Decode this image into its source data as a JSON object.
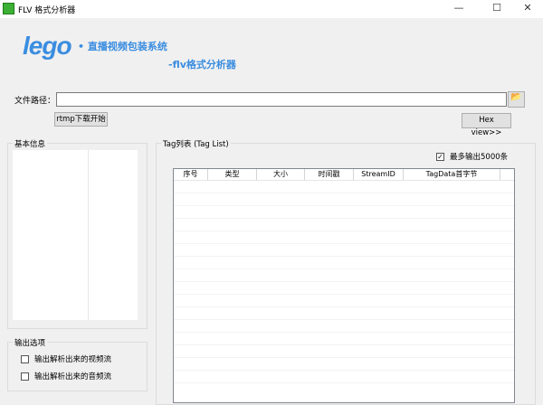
{
  "window": {
    "title": "FLV 格式分析器",
    "minimize": "—",
    "maximize": "☐",
    "close": "✕"
  },
  "brand": {
    "logo": "lego",
    "subtitle1": "• 直播视频包装系统",
    "subtitle2": "-flv格式分析器",
    "color": "#3a8de0"
  },
  "file": {
    "label": "文件路径：",
    "value": "",
    "browse_icon": "folder-open-icon"
  },
  "buttons": {
    "rtmp": "rtmp下载开始",
    "hex": "Hex view>>"
  },
  "basic_info": {
    "title": "基本信息"
  },
  "output_options": {
    "title": "输出选项",
    "video": {
      "label": "输出解析出来的视频流",
      "checked": false
    },
    "audio": {
      "label": "输出解析出来的音频流",
      "checked": false
    }
  },
  "tag_list": {
    "title": "Tag列表 (Tag List)",
    "max_output": {
      "label": "最多输出5000条",
      "checked": true
    },
    "columns": [
      "序号",
      "类型",
      "大小",
      "时间戳",
      "StreamID",
      "TagData首字节",
      ""
    ]
  }
}
